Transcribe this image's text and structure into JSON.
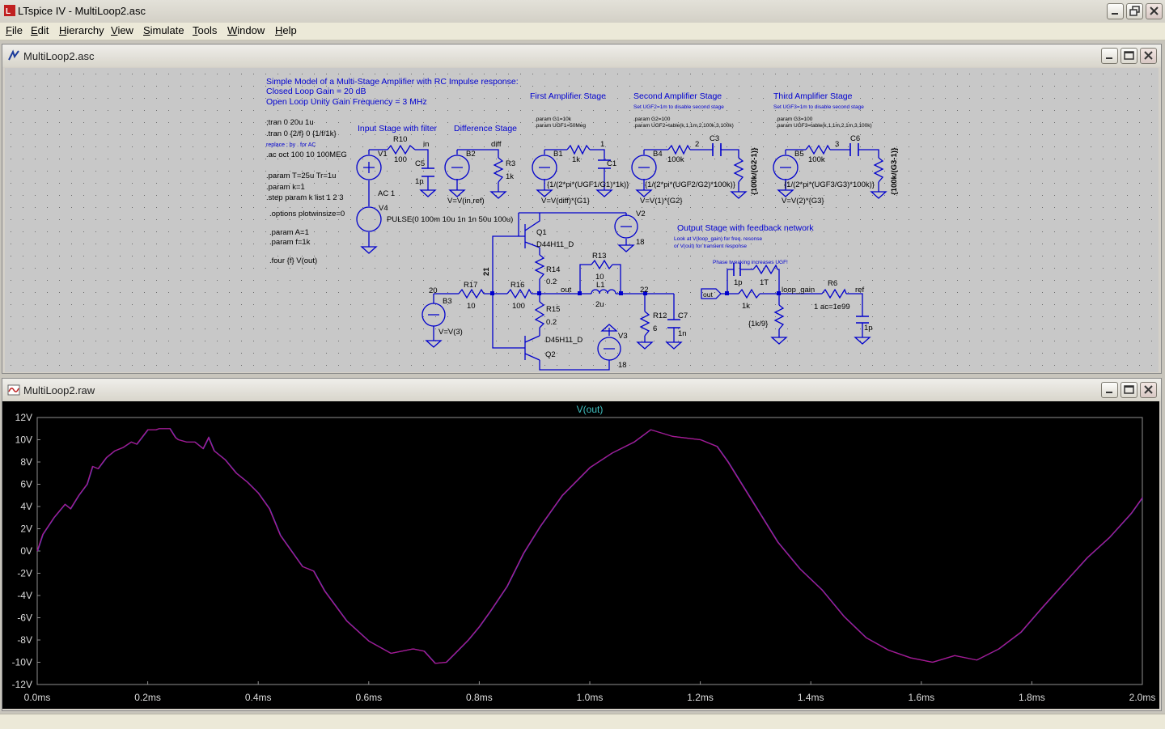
{
  "app": {
    "title": "LTspice IV - MultiLoop2.asc"
  },
  "menu": [
    "File",
    "Edit",
    "Hierarchy",
    "View",
    "Simulate",
    "Tools",
    "Window",
    "Help"
  ],
  "schematic_window": {
    "title": "MultiLoop2.asc",
    "header": {
      "line1": "Simple Model of a Multi-Stage Amplifier with RC Impulse response:",
      "line2": "Closed Loop Gain = 20 dB",
      "line3": "Open Loop Unity Gain Frequency = 3 MHz"
    },
    "directives": [
      ";tran 0 20u 1u",
      ".tran 0 {2/f} 0 {1/f/1k}",
      ".ac oct 100 10 100MEG",
      ".param T=25u Tr=1u",
      ".param k=1",
      ".step param k list 1 2 3",
      ".options plotwinsize=0",
      ".param A=1",
      ".param f=1k",
      ".four {f} V(out)"
    ],
    "replace_note": "replace ; by . for AC",
    "section_titles": {
      "input": "Input Stage with filter",
      "difference": "Difference Stage",
      "first": "First Amplifier Stage",
      "second": "Second Amplifier Stage",
      "third": "Third Amplifier Stage",
      "output": "Output Stage with feedback network"
    },
    "small_notes": {
      "second": "Set UGF2=1m to disable second stage",
      "third": "Set UGF3=1m to disable second stage",
      "first_p1": ".param G1=10k",
      "first_p2": ".param UGF1=50Meg",
      "second_p1": ".param G2=100",
      "second_p2": ".param UGF2=table(k,1,1m,2,100k,3,100k)",
      "third_p1": ".param G3=100",
      "third_p2": ".param UGF3=table(k,1,1m,2,1m,3,100k)",
      "output_1": "Look at V(loop_gain) for freq. resonse",
      "output_2": "or V(out) for transient response",
      "phase": "Phase tweaking increases UGF!"
    },
    "labels": {
      "V1": "V1",
      "R10": "R10",
      "R10v": "100",
      "in": "in",
      "C5": "C5",
      "C5v": "1p",
      "AC": "AC 1",
      "V4": "V4",
      "B2": "B2",
      "diff": "diff",
      "R3": "R3",
      "R3v": "1k",
      "B2e": "V=V(in,ref)",
      "B1": "B1",
      "one": "1",
      "R1v": "1k",
      "C1": "C1",
      "C1e": "{1/(2*pi*(UGF1/G1)*1k)}",
      "B1e": "V=V(diff)*{G1}",
      "B4": "B4",
      "R4v": "100k",
      "two": "2",
      "C3": "C3",
      "C3e": "{1/(2*pi*(UGF2/G2)*100k)}",
      "R4e": "{100k/(G2-1)}",
      "B4e": "V=V(1)*{G2}",
      "B5": "B5",
      "R5v": "100k",
      "three": "3",
      "C6": "C6",
      "C6e": "{1/(2*pi*(UGF3/G3)*100k)}",
      "R5e": "{100k/(G3-1)}",
      "B5e": "V=V(2)*{G3}",
      "pulse": "PULSE(0 100m 10u 1n 1n 50u 100u)",
      "Q1": "Q1",
      "Q1m": "D44H11_D",
      "V2": "V2",
      "V2v": "18",
      "R14": "R14",
      "R14v": "0.2",
      "R13": "R13",
      "R13v": "10",
      "L1": "L1",
      "L1v": "2u",
      "n21": "21",
      "n20": "20",
      "R17": "R17",
      "R17v": "10",
      "R16": "R16",
      "R16v": "100",
      "out": "out",
      "n22": "22",
      "R12": "R12",
      "R12v": "6",
      "C7": "C7",
      "C7v": "1n",
      "B3": "B3",
      "B3e": "V=V(3)",
      "R15": "R15",
      "R15v": "0.2",
      "Q2m": "D45H11_D",
      "Q2": "Q2",
      "V3": "V3",
      "V3v": "18",
      "outflag": "out",
      "Cp": "1p",
      "Ct": "1T",
      "Rf": "1k",
      "Rk": "{1k/9}",
      "loop": "loop_gain",
      "R6": "R6",
      "R6v": "1 ac=1e99",
      "ref": "ref",
      "Cref": "1p"
    }
  },
  "waveform_window": {
    "title": "MultiLoop2.raw",
    "trace_label": "V(out)",
    "colors": {
      "background": "#000000",
      "trace1": "#b0148c",
      "trace2": "#3c50c8",
      "trace_label": "#40c0c0",
      "axis_text": "#dcdcdc"
    }
  },
  "chart_data": {
    "type": "line",
    "title": "V(out)",
    "xlabel": "",
    "ylabel": "",
    "xlim": [
      0,
      2.0
    ],
    "ylim": [
      -12,
      12
    ],
    "x_ticks": [
      "0.0ms",
      "0.2ms",
      "0.4ms",
      "0.6ms",
      "0.8ms",
      "1.0ms",
      "1.2ms",
      "1.4ms",
      "1.6ms",
      "1.8ms",
      "2.0ms"
    ],
    "y_ticks": [
      "12V",
      "10V",
      "8V",
      "6V",
      "4V",
      "2V",
      "0V",
      "-2V",
      "-4V",
      "-6V",
      "-8V",
      "-10V",
      "-12V"
    ],
    "grid": false,
    "series": [
      {
        "name": "V(out)",
        "x": [
          0.0,
          0.01,
          0.03,
          0.05,
          0.06,
          0.075,
          0.09,
          0.1,
          0.11,
          0.125,
          0.14,
          0.155,
          0.17,
          0.18,
          0.2,
          0.215,
          0.22,
          0.24,
          0.25,
          0.255,
          0.27,
          0.285,
          0.3,
          0.31,
          0.32,
          0.34,
          0.36,
          0.38,
          0.4,
          0.42,
          0.44,
          0.48,
          0.5,
          0.52,
          0.56,
          0.6,
          0.64,
          0.68,
          0.7,
          0.72,
          0.74,
          0.76,
          0.78,
          0.8,
          0.82,
          0.85,
          0.88,
          0.91,
          0.95,
          1.0,
          1.04,
          1.08,
          1.11,
          1.15,
          1.2,
          1.23,
          1.25,
          1.27,
          1.3,
          1.34,
          1.38,
          1.42,
          1.46,
          1.5,
          1.54,
          1.58,
          1.62,
          1.66,
          1.7,
          1.74,
          1.78,
          1.82,
          1.86,
          1.9,
          1.94,
          1.98,
          2.0
        ],
        "y": [
          0.0,
          1.5,
          3.0,
          4.2,
          3.8,
          5.0,
          6.0,
          7.6,
          7.4,
          8.4,
          9.0,
          9.3,
          9.8,
          9.6,
          10.9,
          10.9,
          11.0,
          11.0,
          10.2,
          10.0,
          9.8,
          9.8,
          9.2,
          10.2,
          9.0,
          8.2,
          7.0,
          6.2,
          5.2,
          3.8,
          1.4,
          -1.4,
          -1.8,
          -3.6,
          -6.3,
          -8.1,
          -9.2,
          -8.8,
          -9.0,
          -10.1,
          -10.0,
          -9.0,
          -8.0,
          -6.8,
          -5.4,
          -3.2,
          -0.2,
          2.2,
          5.0,
          7.5,
          8.8,
          9.8,
          10.9,
          10.3,
          10.0,
          9.4,
          8.0,
          6.4,
          4.0,
          0.8,
          -1.6,
          -3.5,
          -5.9,
          -7.8,
          -8.9,
          -9.6,
          -10.0,
          -9.4,
          -9.8,
          -8.8,
          -7.3,
          -5.0,
          -2.8,
          -0.6,
          1.2,
          3.4,
          4.8
        ]
      }
    ]
  }
}
